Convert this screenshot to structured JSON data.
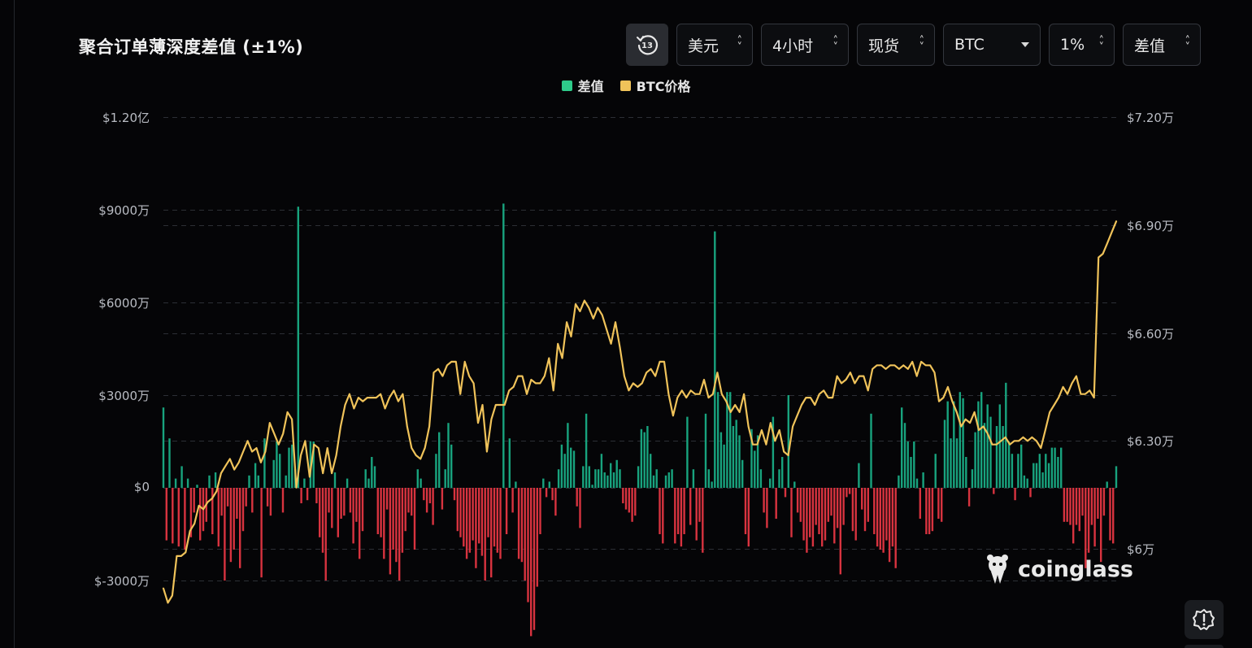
{
  "title": "聚合订单薄深度差值 (±1%)",
  "toolbar": {
    "refresh_label": "13",
    "currency": "美元",
    "interval": "4小时",
    "market": "现货",
    "symbol": "BTC",
    "range": "1%",
    "mode": "差值"
  },
  "watermark": "coinglass",
  "chart_data": {
    "type": "bar",
    "title": "聚合订单薄深度差值 (±1%)",
    "legend": [
      {
        "name": "差值",
        "color": "#2ecb8a"
      },
      {
        "name": "BTC价格",
        "color": "#f0c35a"
      }
    ],
    "legend_position": "top-center",
    "grid": true,
    "positive_color": "#18a37e",
    "negative_color": "#d8333f",
    "price_color": "#f0c35a",
    "y_left": {
      "range": [
        -30000000,
        120000000
      ],
      "ticks": [
        -30000000,
        0,
        30000000,
        60000000,
        90000000,
        120000000
      ],
      "tick_labels": [
        "$-3000万",
        "$0",
        "$3000万",
        "$6000万",
        "$9000万",
        "$1.20亿"
      ]
    },
    "y_right": {
      "range": [
        57500,
        72000
      ],
      "ticks": [
        60000,
        63000,
        66000,
        69000,
        72000
      ],
      "tick_labels": [
        "$6万",
        "$6.30万",
        "$6.60万",
        "$6.90万",
        "$7.20万"
      ]
    },
    "series": [
      {
        "name": "差值",
        "type": "bar",
        "values": [
          26000000,
          -17000000,
          16000000,
          -18000000,
          3000000,
          -19000000,
          7000000,
          -20000000,
          3000000,
          -16000000,
          -8000000,
          1000000,
          -17000000,
          -14000000,
          -11000000,
          4000000,
          -15000000,
          5000000,
          -19000000,
          -9000000,
          -30000000,
          -6000000,
          -24000000,
          -20000000,
          -10000000,
          -26000000,
          -14000000,
          -6000000,
          4000000,
          -8000000,
          8000000,
          4000000,
          -29000000,
          16000000,
          -6000000,
          -9000000,
          9000000,
          15000000,
          11000000,
          -8000000,
          4000000,
          13000000,
          14000000,
          6000000,
          91000000,
          -5000000,
          3000000,
          -4000000,
          15000000,
          15000000,
          -5000000,
          -16000000,
          -21000000,
          -30000000,
          -8000000,
          -13000000,
          5000000,
          -16000000,
          -10000000,
          -9000000,
          3000000,
          -8000000,
          -18000000,
          -11000000,
          -23000000,
          -14000000,
          6000000,
          3000000,
          10000000,
          7000000,
          -15000000,
          -16000000,
          -23000000,
          -7000000,
          -28000000,
          -20000000,
          -24000000,
          -30000000,
          -21000000,
          -14000000,
          -8000000,
          -9000000,
          -20000000,
          6000000,
          3000000,
          -4000000,
          -8000000,
          -5000000,
          -12000000,
          11000000,
          18000000,
          -7000000,
          6000000,
          21000000,
          14000000,
          -4000000,
          -14000000,
          -16000000,
          -19000000,
          -23000000,
          -21000000,
          -17000000,
          -26000000,
          -18000000,
          -22000000,
          -30000000,
          -16000000,
          -29000000,
          -19000000,
          -21000000,
          -23000000,
          92000000,
          -15000000,
          16000000,
          -8000000,
          2000000,
          -23000000,
          -24000000,
          -30000000,
          -37000000,
          -48000000,
          -46000000,
          -32000000,
          -15000000,
          3000000,
          -3000000,
          2000000,
          -4000000,
          -9000000,
          6000000,
          14000000,
          11000000,
          21000000,
          13000000,
          12000000,
          -6000000,
          -13000000,
          7000000,
          24000000,
          7000000,
          1000000,
          6000000,
          6000000,
          11000000,
          5000000,
          4000000,
          8000000,
          5000000,
          9000000,
          6000000,
          -5000000,
          -7000000,
          -8000000,
          -11000000,
          -9000000,
          7000000,
          19000000,
          18000000,
          20000000,
          11000000,
          4000000,
          6000000,
          -15000000,
          -18000000,
          4000000,
          5000000,
          6000000,
          -18000000,
          -15000000,
          -19000000,
          -15000000,
          23000000,
          -12000000,
          6000000,
          -17000000,
          -11000000,
          -21000000,
          24000000,
          6000000,
          2000000,
          83000000,
          31000000,
          18000000,
          14000000,
          31000000,
          31000000,
          20000000,
          22000000,
          17000000,
          9000000,
          -15000000,
          -19000000,
          19000000,
          12000000,
          17000000,
          6000000,
          -8000000,
          -13000000,
          3000000,
          23000000,
          -10000000,
          6000000,
          10000000,
          -3000000,
          30000000,
          -16000000,
          2000000,
          -8000000,
          -11000000,
          -17000000,
          -21000000,
          -16000000,
          -19000000,
          -12000000,
          -15000000,
          -19000000,
          -17000000,
          -11000000,
          -9000000,
          -18000000,
          -13000000,
          -28000000,
          -12000000,
          -3000000,
          -2000000,
          -14000000,
          -17000000,
          8000000,
          -7000000,
          -14000000,
          -11000000,
          24000000,
          -15000000,
          -19000000,
          -20000000,
          -21000000,
          -17000000,
          -24000000,
          -19000000,
          -26000000,
          4000000,
          26000000,
          21000000,
          15000000,
          10000000,
          15000000,
          3000000,
          -10000000,
          5000000,
          -15000000,
          -15000000,
          -14000000,
          11000000,
          -10000000,
          -11000000,
          22000000,
          28000000,
          16000000,
          28000000,
          16000000,
          31000000,
          29000000,
          10000000,
          -6000000,
          6000000,
          18000000,
          28000000,
          31000000,
          21000000,
          27000000,
          23000000,
          -2000000,
          20000000,
          27000000,
          20000000,
          34000000,
          15000000,
          11000000,
          -4000000,
          11000000,
          14000000,
          4000000,
          3000000,
          -3000000,
          8000000,
          8000000,
          11000000,
          5000000,
          11000000,
          8000000,
          13000000,
          13000000,
          10000000,
          13000000,
          -11000000,
          -11000000,
          -12000000,
          -18000000,
          -12000000,
          -14000000,
          -9000000,
          -26000000,
          -21000000,
          -12000000,
          -19000000,
          -10000000,
          -24000000,
          -9000000,
          2000000,
          -17000000,
          -18000000,
          7000000
        ]
      },
      {
        "name": "BTC价格",
        "type": "line",
        "values": [
          58900,
          58500,
          58700,
          59800,
          59800,
          59900,
          60500,
          60700,
          61200,
          61100,
          61300,
          61400,
          61600,
          62100,
          62300,
          62500,
          62200,
          62400,
          62700,
          63000,
          62700,
          62800,
          62400,
          62700,
          63500,
          63200,
          62900,
          63200,
          63800,
          63600,
          61700,
          62600,
          63000,
          62000,
          62900,
          62800,
          62100,
          62800,
          62100,
          62600,
          63400,
          64000,
          64300,
          63900,
          64200,
          64100,
          64200,
          64200,
          64200,
          64300,
          63900,
          64200,
          64400,
          64100,
          64300,
          63400,
          62800,
          62600,
          62500,
          62800,
          63400,
          64900,
          65000,
          64800,
          65100,
          65200,
          65200,
          64300,
          65200,
          64800,
          64600,
          63500,
          64000,
          62700,
          63600,
          64000,
          64000,
          64000,
          64400,
          64500,
          64800,
          64800,
          64300,
          64700,
          64600,
          64600,
          64800,
          65300,
          64400,
          65700,
          65300,
          66300,
          65900,
          66800,
          66600,
          66900,
          66700,
          66400,
          66700,
          66500,
          66100,
          65700,
          66300,
          65600,
          64800,
          64400,
          64600,
          64500,
          64600,
          64900,
          65000,
          64800,
          65200,
          65200,
          64300,
          63700,
          64200,
          64400,
          64200,
          64400,
          64300,
          64300,
          64700,
          64200,
          64300,
          64900,
          64300,
          64100,
          63800,
          64000,
          63800,
          64300,
          63400,
          62900,
          62900,
          63300,
          62900,
          63500,
          63000,
          63300,
          62700,
          62600,
          63400,
          63700,
          64000,
          64200,
          64200,
          64000,
          64300,
          64400,
          64200,
          64200,
          64800,
          64600,
          64700,
          64900,
          64600,
          64800,
          64800,
          64400,
          65000,
          65100,
          65100,
          65000,
          65100,
          65100,
          65000,
          65100,
          65000,
          65200,
          64800,
          65200,
          65100,
          65100,
          64900,
          64100,
          64200,
          64500,
          64100,
          63800,
          63400,
          63600,
          63500,
          63800,
          63300,
          63400,
          63200,
          62900,
          62900,
          63000,
          63100,
          62900,
          63000,
          63000,
          63100,
          63000,
          63100,
          63000,
          62800,
          63300,
          63800,
          64000,
          64200,
          64500,
          64300,
          64600,
          64800,
          64300,
          64300,
          64400,
          64200,
          68100,
          68200,
          68500,
          68800,
          69100
        ]
      }
    ]
  }
}
